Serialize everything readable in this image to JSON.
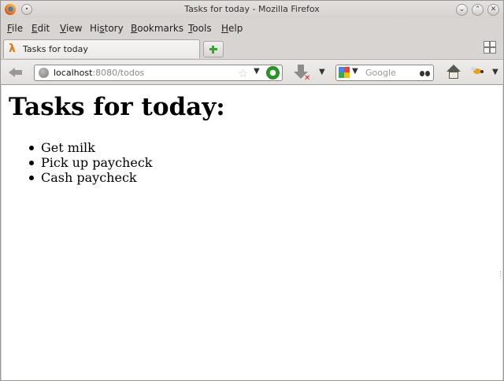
{
  "window": {
    "title": "Tasks for today - Mozilla Firefox"
  },
  "menubar": {
    "items": [
      {
        "accel": "F",
        "rest": "ile"
      },
      {
        "accel": "E",
        "rest": "dit"
      },
      {
        "accel": "V",
        "rest": "iew"
      },
      {
        "accel": "",
        "rest": "History",
        "pre": "Hi",
        "u": "s",
        "post": "tory"
      },
      {
        "accel": "B",
        "rest": "ookmarks"
      },
      {
        "accel": "T",
        "rest": "ools"
      },
      {
        "accel": "H",
        "rest": "elp"
      }
    ]
  },
  "tab": {
    "label": "Tasks for today",
    "icon": "lambda-icon"
  },
  "urlbar": {
    "host": "localhost",
    "rest": ":8080/todos"
  },
  "searchbar": {
    "placeholder": "Google",
    "engine": "google-icon"
  },
  "page": {
    "heading": "Tasks for today:",
    "tasks": [
      "Get milk",
      "Pick up paycheck",
      "Cash paycheck"
    ]
  },
  "colors": {
    "accent_orange": "#e07a12",
    "reload_green": "#2f9c2b",
    "newtab_green": "#3ca12e",
    "stop_red": "#d8201c"
  }
}
